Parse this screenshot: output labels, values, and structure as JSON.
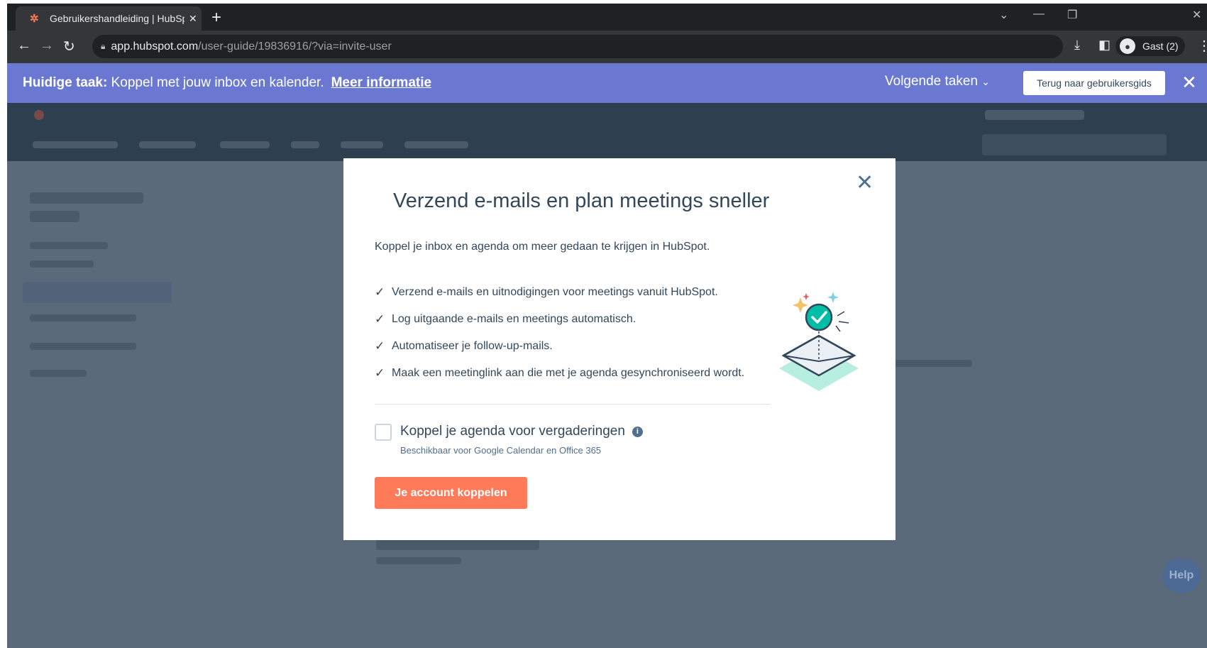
{
  "browser": {
    "tab_title": "Gebruikershandleiding | HubSpot",
    "url_host": "app.hubspot.com",
    "url_path": "/user-guide/19836916/?via=invite-user",
    "profile_label": "Gast (2)"
  },
  "banner": {
    "task_prefix": "Huidige taak:",
    "task_text": "Koppel met jouw inbox en kalender.",
    "more_link": "Meer informatie",
    "next_tasks": "Volgende taken",
    "back_button": "Terug naar gebruikersgids"
  },
  "modal": {
    "title": "Verzend e-mails en plan meetings sneller",
    "description": "Koppel je inbox en agenda om meer gedaan te krijgen in HubSpot.",
    "benefits": [
      "Verzend e-mails en uitnodigingen voor meetings vanuit HubSpot.",
      "Log uitgaande e-mails en meetings automatisch.",
      "Automatiseer je follow-up-mails.",
      "Maak een meetinglink aan die met je agenda gesynchroniseerd wordt."
    ],
    "checkbox_label": "Koppel je agenda voor vergaderingen",
    "checkbox_checked": false,
    "checkbox_sub": "Beschikbaar voor Google Calendar en Office 365",
    "cta": "Je account koppelen"
  },
  "background": {
    "help_button": "Help"
  },
  "colors": {
    "banner": "#6a78d1",
    "cta": "#ff7a59",
    "text": "#33475b",
    "overlay": "#5b6a7a"
  }
}
